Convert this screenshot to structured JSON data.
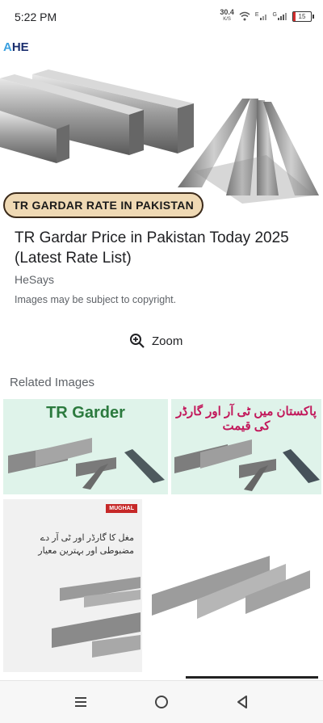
{
  "status_bar": {
    "time": "5:22 PM",
    "speed": "30.4",
    "speed_unit": "K/S",
    "network_e": "E",
    "network_g": "G",
    "battery": "15"
  },
  "hero": {
    "logo_accent": "A",
    "logo_text": "HE",
    "tag": "TR GARDAR RATE IN PAKISTAN"
  },
  "result": {
    "title": "TR Gardar Price in Pakistan Today 2025 (Latest Rate List)",
    "source": "HeSays",
    "copyright": "Images may be subject to copyright.",
    "zoom_label": "Zoom",
    "zoom_icon": "zoom-in-icon"
  },
  "related": {
    "label": "Related Images",
    "tiles": [
      {
        "title": "TR Garder"
      },
      {
        "title": "پاکستان میں ٹی آر اور گارڈر کی قیمت"
      },
      {
        "brand": "MUGHAL",
        "text": "مغل کا گارڈر اور ٹی آر دے مضبوطی اور بہترین معیار"
      },
      {}
    ]
  },
  "nav": {
    "recents_icon": "recents-icon",
    "home_icon": "home-icon",
    "back_icon": "back-icon"
  }
}
